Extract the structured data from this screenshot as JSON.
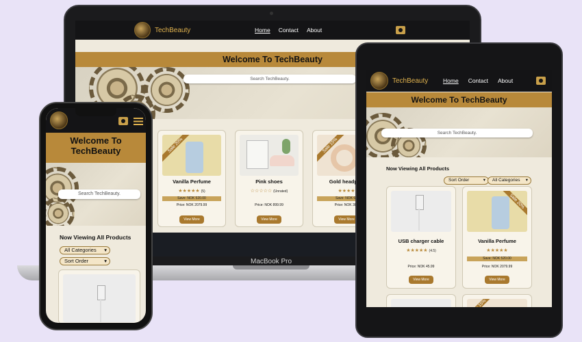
{
  "brand": {
    "name": "TechBeauty",
    "accent": "#b8893a",
    "nav_bg": "#141416"
  },
  "nav": {
    "home": "Home",
    "contact": "Contact",
    "about": "About"
  },
  "welcome": "Welcome To TechBeauty",
  "welcome_line1": "Welcome To",
  "welcome_line2": "TechBeauty",
  "search_placeholder": "Search TechBeauty.",
  "laptop_label": "MacBook Pro",
  "viewing_heading": "Now Viewing All Products",
  "filters": {
    "sort": "Sort Order",
    "category": "All Categories"
  },
  "laptop_products": [
    {
      "ribbon": "Sale 20%",
      "name": "Vanilla Perfume",
      "stars": "★★★★★",
      "rating_count": "(5)",
      "save": "Save: NOK 520.00",
      "price": "Price: NOK 2079.99",
      "button": "View More"
    },
    {
      "ribbon": "",
      "name": "Pink shoes",
      "stars": "☆☆☆☆☆",
      "rating_count": "(Unrated)",
      "save": "",
      "price": "Price: NOK 899.99",
      "button": "View More"
    },
    {
      "ribbon": "Sale 15%",
      "name": "Gold headpho",
      "stars": "★★★★",
      "rating_count": "",
      "save": "Save: NOK 67",
      "price": "Price: NOK 382",
      "button": "View More"
    }
  ],
  "tablet_products": [
    {
      "ribbon": "",
      "name": "USB charger cable",
      "stars": "★★★★★",
      "rating_count": "(4.5)",
      "save": "",
      "price": "Price: NOK 45.99",
      "button": "View More"
    },
    {
      "ribbon": "Sale 20%",
      "name": "Vanilla Perfume",
      "stars": "★★★★★",
      "rating_count": "",
      "save": "Save: NOK 520.00",
      "price": "Price: NOK 2079.99",
      "button": "View More"
    },
    {
      "ribbon": "",
      "name": "",
      "stars": "",
      "rating_count": "",
      "save": "",
      "price": "",
      "button": ""
    },
    {
      "ribbon": "Sale 15%",
      "name": "",
      "stars": "",
      "rating_count": "",
      "save": "",
      "price": "",
      "button": ""
    }
  ],
  "icons": {
    "logo": "watch-logo-icon",
    "cart": "cart-icon",
    "menu": "hamburger-menu-icon"
  }
}
